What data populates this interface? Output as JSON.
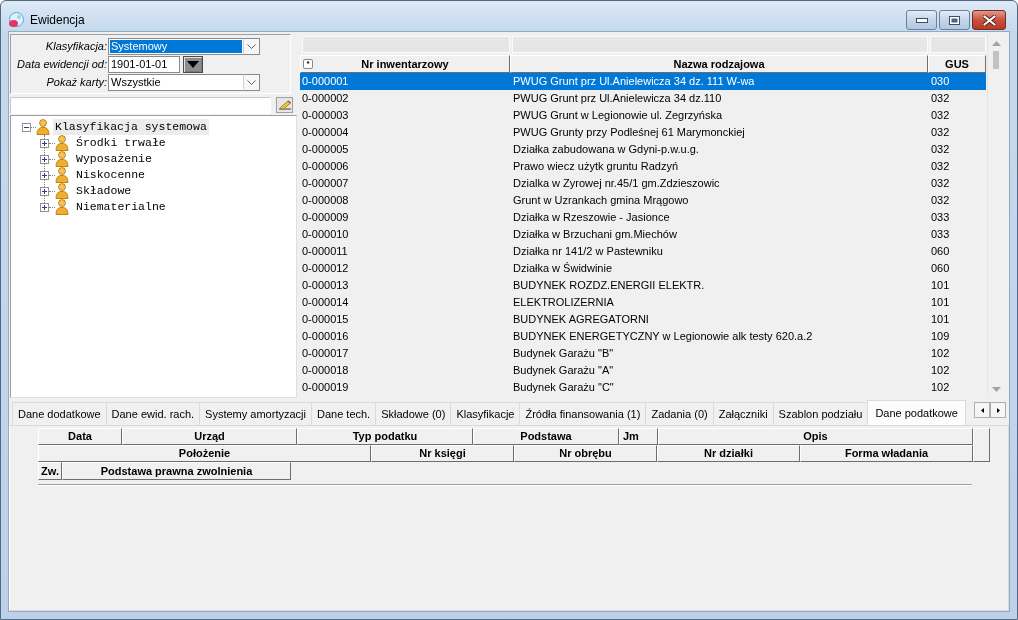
{
  "window": {
    "title": "Ewidencja"
  },
  "filters": [
    {
      "kind": "combo",
      "label": "Klasyfikacja:",
      "value": "Systemowy",
      "selected": true
    },
    {
      "kind": "date",
      "label": "Data ewidencji od:",
      "value": "1901-01-01",
      "selected": false
    },
    {
      "kind": "combo",
      "label": "Pokaż karty:",
      "value": "Wszystkie",
      "selected": false
    }
  ],
  "tree": [
    {
      "label": "Klasyfikacja systemowa",
      "expanded": true,
      "selected": true,
      "children": [
        {
          "label": "Środki trwałe",
          "expanded": false,
          "selected": false
        },
        {
          "label": "Wyposażenie",
          "expanded": false,
          "selected": false
        },
        {
          "label": "Niskocenne",
          "expanded": false,
          "selected": false
        },
        {
          "label": "Składowe",
          "expanded": false,
          "selected": false
        },
        {
          "label": "Niematerialne",
          "expanded": false,
          "selected": false
        }
      ]
    }
  ],
  "table": {
    "corner_button": "*",
    "columns": [
      "Nr inwentarzowy",
      "Nazwa rodzajowa",
      "GUS"
    ],
    "rows": [
      {
        "cells": [
          "0-000001",
          "PWUG Grunt prz Ul.Anielewicza 34 dz. 111 W-wa",
          "030"
        ],
        "selected": true
      },
      {
        "cells": [
          "0-000002",
          "PWUG Grunt prz Ul.Anielewicza 34 dz.110",
          "032"
        ],
        "selected": false
      },
      {
        "cells": [
          "0-000003",
          "PWUG Grunt w Legionowie ul. Zegrzyńska",
          "032"
        ],
        "selected": false
      },
      {
        "cells": [
          "0-000004",
          "PWUG Grunty przy Podleśnej 61 Marymonckiej",
          "032"
        ],
        "selected": false
      },
      {
        "cells": [
          "0-000005",
          "Działka zabudowana w Gdyni-p.w.u.g.",
          "032"
        ],
        "selected": false
      },
      {
        "cells": [
          "0-000006",
          "Prawo wiecz użytk gruntu Radzyń",
          "032"
        ],
        "selected": false
      },
      {
        "cells": [
          "0-000007",
          "Dzialka w Zyrowej nr.45/1 gm.Zdzieszowic",
          "032"
        ],
        "selected": false
      },
      {
        "cells": [
          "0-000008",
          "Grunt w Uzrankach gmina Mrągowo",
          "032"
        ],
        "selected": false
      },
      {
        "cells": [
          "0-000009",
          "Działka w Rzeszowie - Jasionce",
          "033"
        ],
        "selected": false
      },
      {
        "cells": [
          "0-000010",
          "Działka w Brzuchani gm.Miechów",
          "033"
        ],
        "selected": false
      },
      {
        "cells": [
          "0-000011",
          "Działka nr 141/2 w Pastewniku",
          "060"
        ],
        "selected": false
      },
      {
        "cells": [
          "0-000012",
          "Działka w Świdwinie",
          "060"
        ],
        "selected": false
      },
      {
        "cells": [
          "0-000013",
          "BUDYNEK ROZDZ.ENERGII ELEKTR.",
          "101"
        ],
        "selected": false
      },
      {
        "cells": [
          "0-000014",
          "ELEKTROLIZERNIA",
          "101"
        ],
        "selected": false
      },
      {
        "cells": [
          "0-000015",
          "BUDYNEK AGREGATORNI",
          "101"
        ],
        "selected": false
      },
      {
        "cells": [
          "0-000016",
          "BUDYNEK ENERGETYCZNY w Legionowie alk testy 620.a.2",
          "109"
        ],
        "selected": false
      },
      {
        "cells": [
          "0-000017",
          "Budynek Garażu \"B\"",
          "102"
        ],
        "selected": false
      },
      {
        "cells": [
          "0-000018",
          "Budynek Garażu \"A\"",
          "102"
        ],
        "selected": false
      },
      {
        "cells": [
          "0-000019",
          "Budynek Garażu \"C\"",
          "102"
        ],
        "selected": false
      }
    ]
  },
  "tabs": [
    {
      "label": "Dane dodatkowe",
      "selected": false
    },
    {
      "label": "Dane ewid. rach.",
      "selected": false
    },
    {
      "label": "Systemy amortyzacji",
      "selected": false
    },
    {
      "label": "Dane tech.",
      "selected": false
    },
    {
      "label": "Składowe (0)",
      "selected": false
    },
    {
      "label": "Klasyfikacje",
      "selected": false
    },
    {
      "label": "Źródła finansowania (1)",
      "selected": false
    },
    {
      "label": "Zadania (0)",
      "selected": false
    },
    {
      "label": "Załączniki",
      "selected": false
    },
    {
      "label": "Szablon podziału",
      "selected": false
    },
    {
      "label": "Dane podatkowe",
      "selected": true
    }
  ],
  "tax_grid": {
    "header_rows": [
      [
        "Data",
        "Urząd",
        "Typ podatku",
        "Podstawa",
        "Jm",
        "Opis"
      ],
      [
        "Położenie",
        "Nr księgi",
        "Nr obrębu",
        "Nr działki",
        "Forma władania"
      ],
      [
        "Zw.",
        "Podstawa prawna zwolnienia"
      ]
    ]
  }
}
